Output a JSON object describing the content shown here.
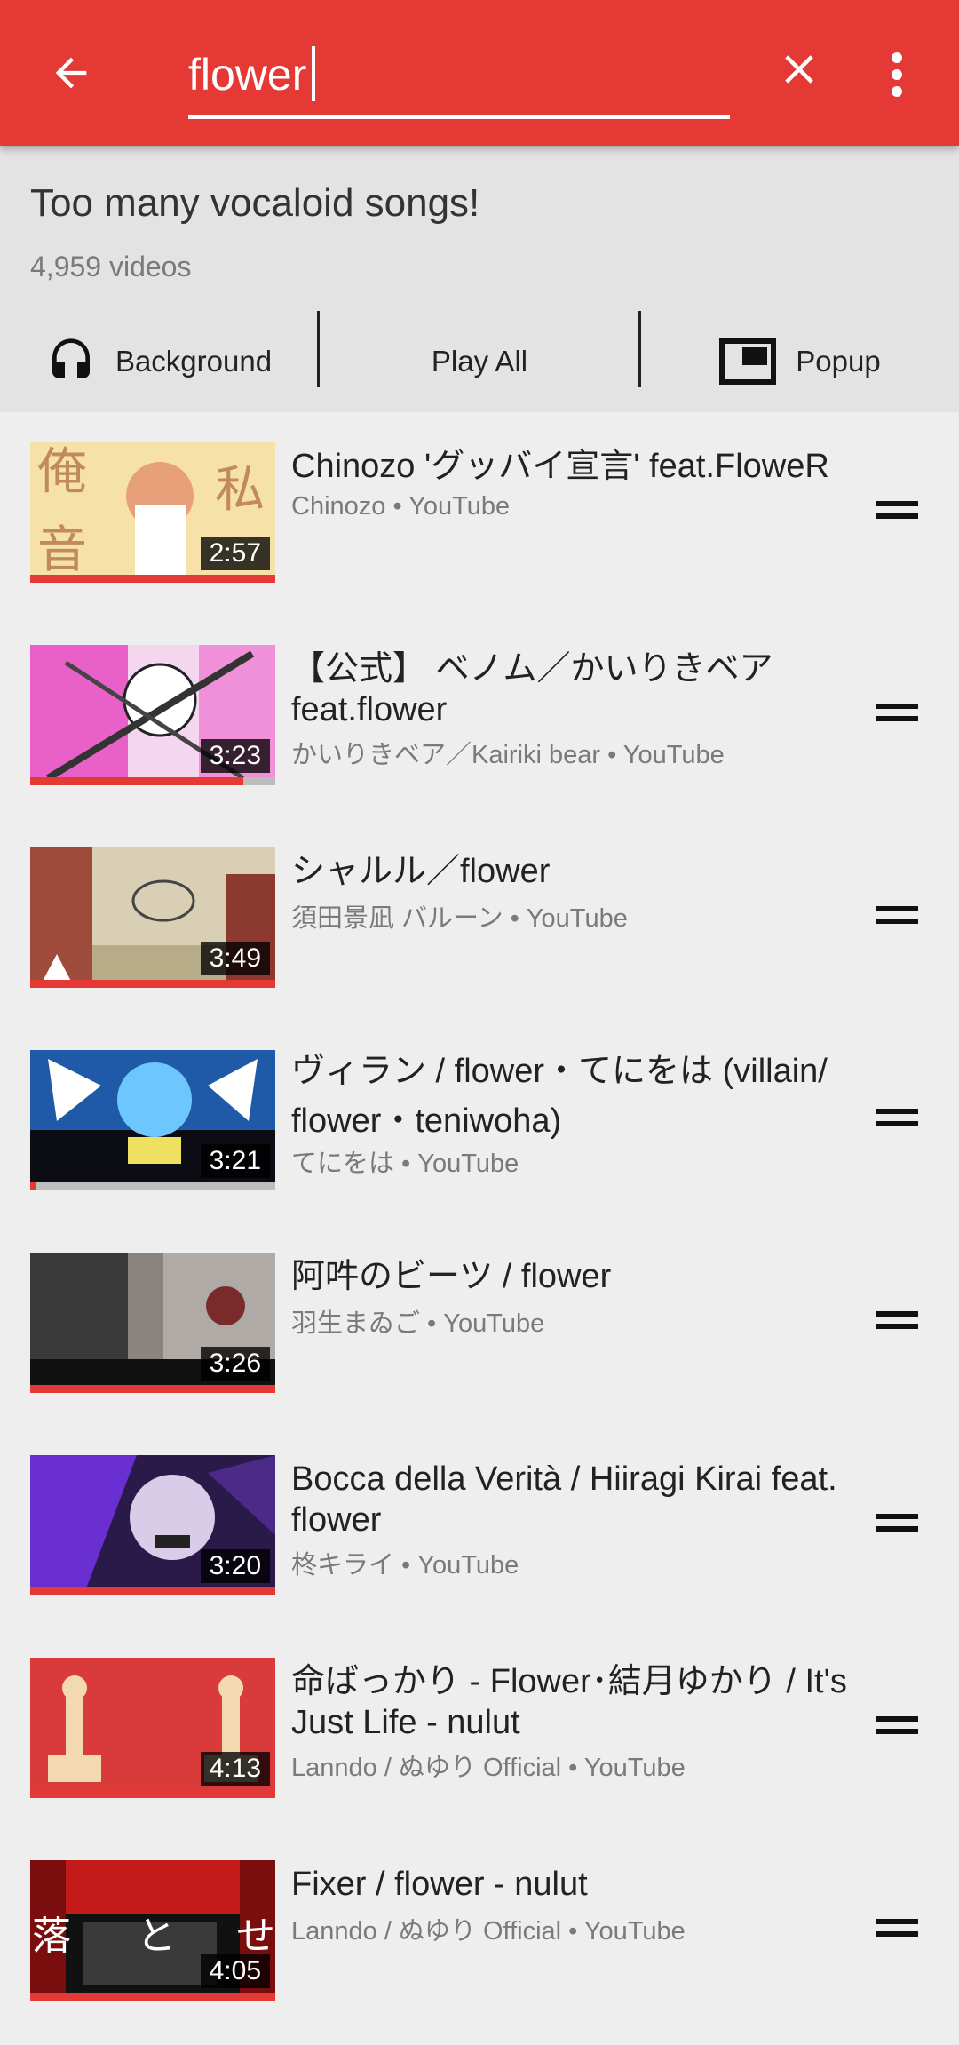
{
  "search": {
    "value": "flower"
  },
  "playlist": {
    "title": "Too many vocaloid songs!",
    "count": "4,959 videos"
  },
  "actions": {
    "background": "Background",
    "play_all": "Play All",
    "popup": "Popup"
  },
  "colors": {
    "accent": "#e53935"
  },
  "icons": [
    "arrow-back-icon",
    "close-icon",
    "more-vert-icon",
    "headphones-icon",
    "popup-icon",
    "drag-handle-icon"
  ],
  "videos": [
    {
      "title": "Chinozo  'グッバイ宣言' feat.FloweR",
      "subtitle": "Chinozo • YouTube",
      "duration": "2:57",
      "progress": 1.0
    },
    {
      "title": "【公式】 ベノム／かいりきベア feat.flower",
      "subtitle": "かいりきベア／Kairiki bear • YouTube",
      "duration": "3:23",
      "progress": 0.87
    },
    {
      "title": "シャルル／flower",
      "subtitle": "須田景凪 バルーン • YouTube",
      "duration": "3:49",
      "progress": 1.0
    },
    {
      "title": "ヴィラン / flower・てにをは (villain/ flower・teniwoha)",
      "subtitle": "てにをは • YouTube",
      "duration": "3:21",
      "progress": 0.02
    },
    {
      "title": "阿吽のビーツ / flower",
      "subtitle": "羽生まゐご • YouTube",
      "duration": "3:26",
      "progress": 1.0
    },
    {
      "title": "Bocca della Verità / Hiiragi Kirai feat. flower",
      "subtitle": "柊キライ • YouTube",
      "duration": "3:20",
      "progress": 1.0
    },
    {
      "title": "命ばっかり - Flower･結月ゆかり / It's Just Life - nulut",
      "subtitle": "Lanndo / ぬゆり Official • YouTube",
      "duration": "4:13",
      "progress": 1.0
    },
    {
      "title": "Fixer / flower - nulut",
      "subtitle": "Lanndo / ぬゆり Official • YouTube",
      "duration": "4:05",
      "progress": 1.0
    }
  ]
}
